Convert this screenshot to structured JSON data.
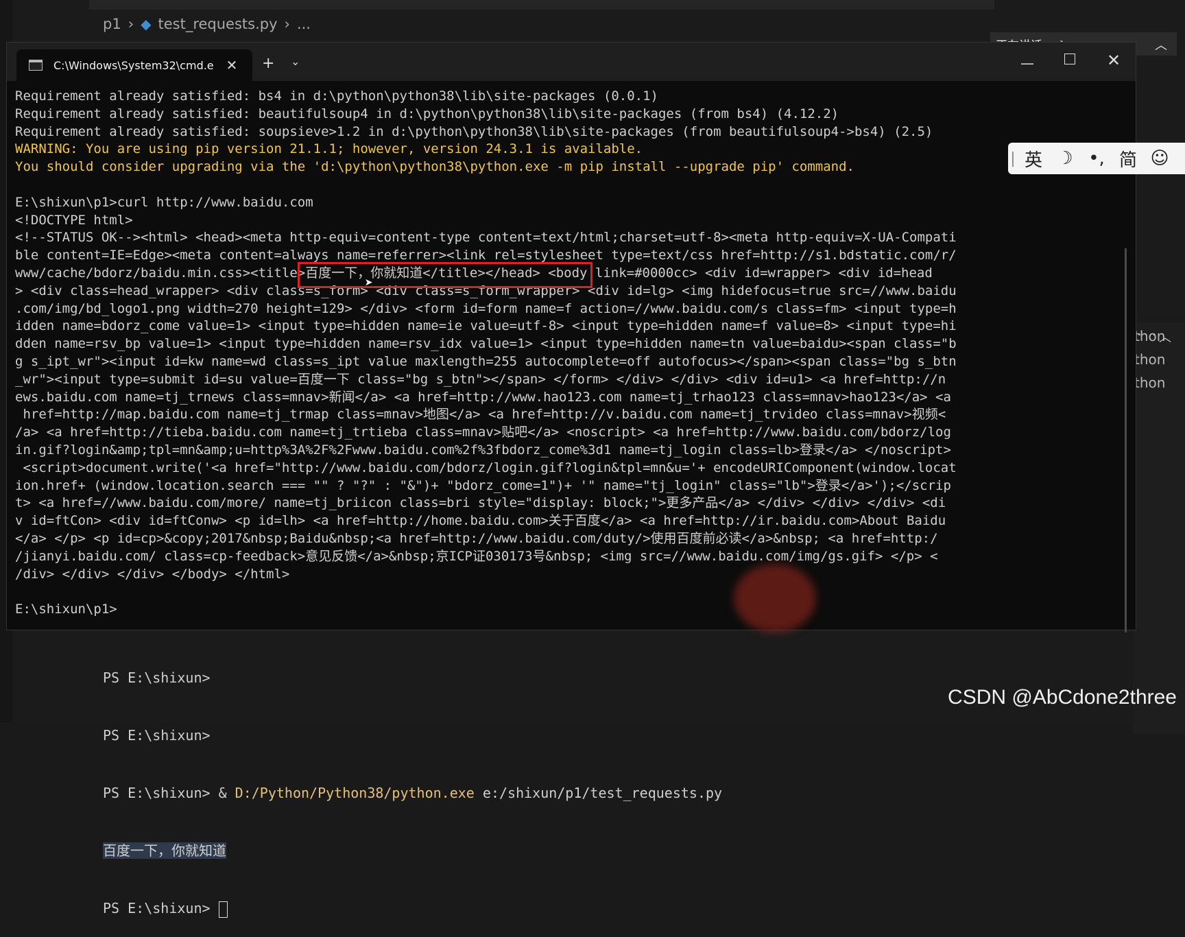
{
  "editor": {
    "breadcrumb": [
      "p1",
      "test_requests.py",
      "..."
    ]
  },
  "speaking_banner": {
    "text": "正在讲话：skywen"
  },
  "cmd": {
    "tab_title": "C:\\Windows\\System32\\cmd.e",
    "new_tab_glyph": "+",
    "dropdown_glyph": "⌄",
    "close_tab_glyph": "✕",
    "min_glyph": "—",
    "close_glyph": "✕",
    "lines": [
      "Requirement already satisfied: bs4 in d:\\python\\python38\\lib\\site-packages (0.0.1)",
      "Requirement already satisfied: beautifulsoup4 in d:\\python\\python38\\lib\\site-packages (from bs4) (4.12.2)",
      "Requirement already satisfied: soupsieve>1.2 in d:\\python\\python38\\lib\\site-packages (from beautifulsoup4->bs4) (2.5)",
      "WARNING: You are using pip version 21.1.1; however, version 24.3.1 is available.",
      "You should consider upgrading via the 'd:\\python\\python38\\python.exe -m pip install --upgrade pip' command.",
      "",
      "E:\\shixun\\p1>curl http://www.baidu.com",
      "<!DOCTYPE html>",
      "<!--STATUS OK--><html> <head><meta http-equiv=content-type content=text/html;charset=utf-8><meta http-equiv=X-UA-Compati",
      "ble content=IE=Edge><meta content=always name=referrer><link rel=stylesheet type=text/css href=http://s1.bdstatic.com/r/",
      "www/cache/bdorz/baidu.min.css><title>百度一下，你就知道</title></head> <body link=#0000cc> <div id=wrapper> <div id=head",
      "> <div class=head_wrapper> <div class=s_form> <div class=s_form_wrapper> <div id=lg> <img hidefocus=true src=//www.baidu",
      ".com/img/bd_logo1.png width=270 height=129> </div> <form id=form name=f action=//www.baidu.com/s class=fm> <input type=h",
      "idden name=bdorz_come value=1> <input type=hidden name=ie value=utf-8> <input type=hidden name=f value=8> <input type=hi",
      "dden name=rsv_bp value=1> <input type=hidden name=rsv_idx value=1> <input type=hidden name=tn value=baidu><span class=\"b",
      "g s_ipt_wr\"><input id=kw name=wd class=s_ipt value maxlength=255 autocomplete=off autofocus></span><span class=\"bg s_btn",
      "_wr\"><input type=submit id=su value=百度一下 class=\"bg s_btn\"></span> </form> </div> </div> <div id=u1> <a href=http://n",
      "ews.baidu.com name=tj_trnews class=mnav>新闻</a> <a href=http://www.hao123.com name=tj_trhao123 class=mnav>hao123</a> <a",
      " href=http://map.baidu.com name=tj_trmap class=mnav>地图</a> <a href=http://v.baidu.com name=tj_trvideo class=mnav>视频<",
      "/a> <a href=http://tieba.baidu.com name=tj_trtieba class=mnav>贴吧</a> <noscript> <a href=http://www.baidu.com/bdorz/log",
      "in.gif?login&amp;tpl=mn&amp;u=http%3A%2F%2Fwww.baidu.com%2f%3fbdorz_come%3d1 name=tj_login class=lb>登录</a> </noscript>",
      " <script>document.write('<a href=\"http://www.baidu.com/bdorz/login.gif?login&tpl=mn&u='+ encodeURIComponent(window.locat",
      "ion.href+ (window.location.search === \"\" ? \"?\" : \"&\")+ \"bdorz_come=1\")+ '\" name=\"tj_login\" class=\"lb\">登录</a>');</scrip",
      "t> <a href=//www.baidu.com/more/ name=tj_briicon class=bri style=\"display: block;\">更多产品</a> </div> </div> </div> <di",
      "v id=ftCon> <div id=ftConw> <p id=lh> <a href=http://home.baidu.com>关于百度</a> <a href=http://ir.baidu.com>About Baidu",
      "</a> </p> <p id=cp>&copy;2017&nbsp;Baidu&nbsp;<a href=http://www.baidu.com/duty/>使用百度前必读</a>&nbsp; <a href=http:/",
      "/jianyi.baidu.com/ class=cp-feedback>意见反馈</a>&nbsp;京ICP证030173号&nbsp; <img src=//www.baidu.com/img/gs.gif> </p> <",
      "/div> </div> </div> </body> </html>",
      "",
      "E:\\shixun\\p1>"
    ],
    "warning_line_indices": [
      3,
      4
    ]
  },
  "ime": {
    "handle": "|",
    "lang": "英",
    "moon": "☽",
    "punct": "•,",
    "simplified": "简",
    "emoji": "☺"
  },
  "right_panel": {
    "lines": [
      "thon",
      "thon",
      "thon"
    ],
    "dots": "· ·"
  },
  "powershell": {
    "lines": [
      "PS E:\\shixun>",
      "PS E:\\shixun>"
    ],
    "cmd_prefix": "PS E:\\shixun> & ",
    "cmd_path": "D:/Python/Python38/python.exe",
    "cmd_arg": " e:/shixun/p1/test_requests.py",
    "output": "百度一下，你就知道",
    "final_prompt": "PS E:\\shixun> "
  },
  "watermark": "CSDN @AbCdone2three",
  "colors": {
    "warning": "#f3c64b",
    "highlight_box": "#e02020",
    "ps_path": "#e5c07b"
  }
}
